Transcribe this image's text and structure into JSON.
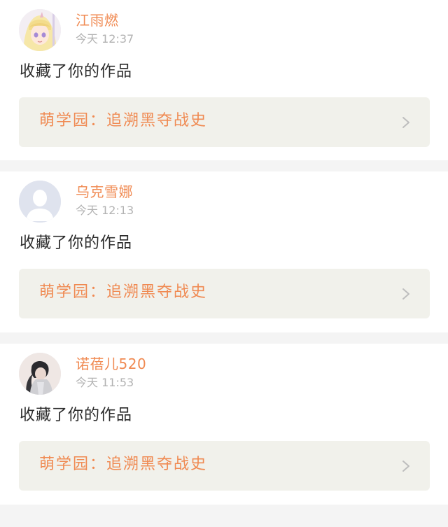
{
  "notifications": [
    {
      "username": "江雨燃",
      "time": "今天 12:37",
      "action": "收藏了你的作品",
      "work_title": "萌学园：追溯黑夺战史",
      "avatar_icon": "anime-girl-avatar"
    },
    {
      "username": "乌克雪娜",
      "time": "今天 12:13",
      "action": "收藏了你的作品",
      "work_title": "萌学园：追溯黑夺战史",
      "avatar_icon": "default-user-avatar"
    },
    {
      "username": "诺蓓儿520",
      "time": "今天 11:53",
      "action": "收藏了你的作品",
      "work_title": "萌学园：追溯黑夺战史",
      "avatar_icon": "photo-avatar"
    }
  ],
  "colors": {
    "accent": "#f08a52",
    "muted": "#b2b2b2",
    "card_link_bg": "#f1f1eb",
    "page_bg": "#f4f4f4"
  }
}
